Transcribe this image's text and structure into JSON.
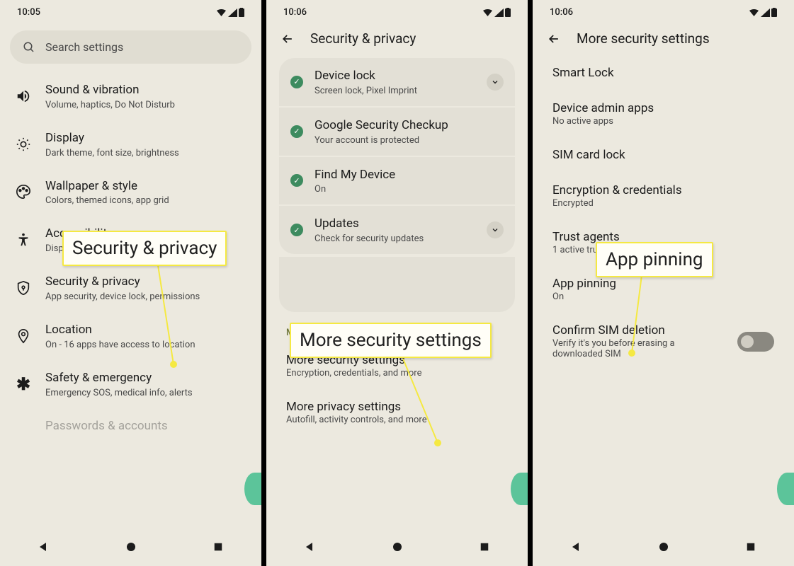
{
  "phone1": {
    "time": "10:05",
    "search_placeholder": "Search settings",
    "items": [
      {
        "title": "Sound & vibration",
        "subtitle": "Volume, haptics, Do Not Disturb"
      },
      {
        "title": "Display",
        "subtitle": "Dark theme, font size, brightness"
      },
      {
        "title": "Wallpaper & style",
        "subtitle": "Colors, themed icons, app grid"
      },
      {
        "title": "Accessibility",
        "subtitle": "Display, interaction, audio"
      },
      {
        "title": "Security & privacy",
        "subtitle": "App security, device lock, permissions"
      },
      {
        "title": "Location",
        "subtitle": "On - 16 apps have access to location"
      },
      {
        "title": "Safety & emergency",
        "subtitle": "Emergency SOS, medical info, alerts"
      },
      {
        "title": "Passwords & accounts",
        "subtitle": ""
      }
    ],
    "highlight": "Security & privacy"
  },
  "phone2": {
    "time": "10:06",
    "header": "Security & privacy",
    "cards": [
      {
        "title": "Device lock",
        "subtitle": "Screen lock, Pixel Imprint",
        "chevron": true
      },
      {
        "title": "Google Security Checkup",
        "subtitle": "Your account is protected",
        "chevron": false
      },
      {
        "title": "Find My Device",
        "subtitle": "On",
        "chevron": false
      },
      {
        "title": "Updates",
        "subtitle": "Check for security updates",
        "chevron": true
      }
    ],
    "section_label": "More settings",
    "more_items": [
      {
        "title": "More security settings",
        "subtitle": "Encryption, credentials, and more"
      },
      {
        "title": "More privacy settings",
        "subtitle": "Autofill, activity controls, and more"
      }
    ],
    "highlight": "More security settings"
  },
  "phone3": {
    "time": "10:06",
    "header": "More security settings",
    "items": [
      {
        "title": "Smart Lock",
        "subtitle": ""
      },
      {
        "title": "Device admin apps",
        "subtitle": "No active apps"
      },
      {
        "title": "SIM card lock",
        "subtitle": ""
      },
      {
        "title": "Encryption & credentials",
        "subtitle": "Encrypted"
      },
      {
        "title": "Trust agents",
        "subtitle": "1 active trust agent"
      },
      {
        "title": "App pinning",
        "subtitle": "On"
      },
      {
        "title": "Confirm SIM deletion",
        "subtitle": "Verify it's you before erasing a downloaded SIM"
      }
    ],
    "highlight": "App pinning"
  }
}
